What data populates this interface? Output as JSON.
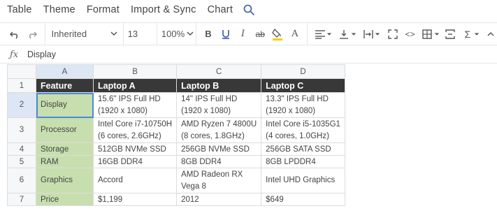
{
  "menu": {
    "items": [
      "Table",
      "Theme",
      "Format",
      "Import & Sync",
      "Chart"
    ],
    "search_icon": "search-icon"
  },
  "toolbar": {
    "font": "Inherited",
    "font_size": "13",
    "zoom": "100%",
    "underline_color": "#2e8b57",
    "fill_color": "#f5d000"
  },
  "formula": {
    "icon": "fx",
    "value": "Display"
  },
  "grid": {
    "columns": [
      "A",
      "B",
      "C",
      "D"
    ],
    "active_column": "A",
    "rows": [
      {
        "n": "1",
        "cells": [
          "Feature",
          "Laptop A",
          "Laptop B",
          "Laptop C"
        ]
      },
      {
        "n": "2",
        "cells": [
          "Display",
          "15.6\" IPS Full HD\n(1920 x 1080)",
          "14\" IPS Full HD\n(1920 x 1080)",
          "13.3\" IPS Full HD\n(1920 x 1080)"
        ]
      },
      {
        "n": "3",
        "cells": [
          "Processor",
          "Intel Core i7-10750H\n(6 cores, 2.6GHz)",
          "AMD Ryzen 7 4800U\n(8 cores, 1.8GHz)",
          "Intel Core i5-1035G1\n(4 cores, 1.0GHz)"
        ]
      },
      {
        "n": "4",
        "cells": [
          "Storage",
          "512GB NVMe SSD",
          "256GB NVMe SSD",
          "256GB SATA SSD"
        ]
      },
      {
        "n": "5",
        "cells": [
          "RAM",
          "16GB DDR4",
          "8GB DDR4",
          "8GB LPDDR4"
        ]
      },
      {
        "n": "6",
        "cells": [
          "Graphics",
          "Accord",
          "AMD Radeon RX\nVega 8",
          "Intel UHD Graphics"
        ]
      },
      {
        "n": "7",
        "cells": [
          "Price",
          "$1,199",
          "2012",
          "$649"
        ]
      }
    ]
  }
}
